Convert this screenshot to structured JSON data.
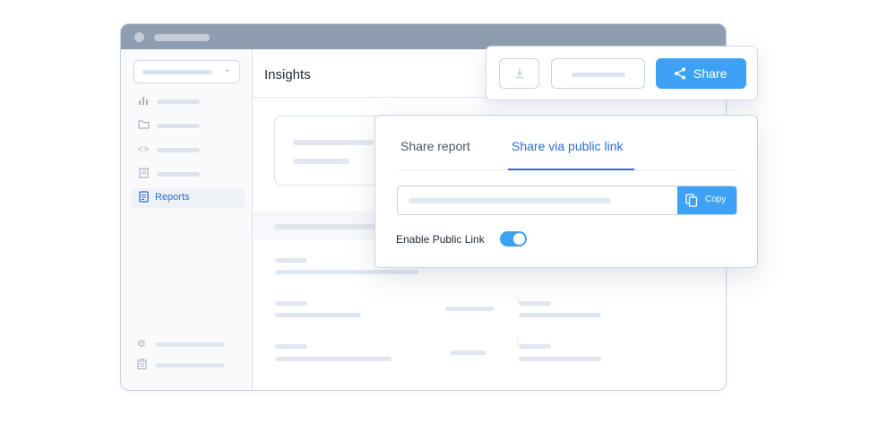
{
  "header": {
    "title": "Insights"
  },
  "sidebar": {
    "items": [
      {
        "icon": "bar-chart-icon"
      },
      {
        "icon": "folder-icon"
      },
      {
        "icon": "code-icon"
      },
      {
        "icon": "documents-icon"
      },
      {
        "icon": "report-icon",
        "label": "Reports",
        "active": true
      }
    ],
    "footer": [
      {
        "icon": "gear-icon"
      },
      {
        "icon": "clipboard-icon"
      }
    ]
  },
  "toolbar": {
    "download_icon": "download-icon",
    "share_label": "Share",
    "share_icon": "share-icon"
  },
  "share_dialog": {
    "tabs": [
      {
        "label": "Share report",
        "active": false
      },
      {
        "label": "Share via public link",
        "active": true
      }
    ],
    "copy_label": "Copy",
    "copy_icon": "copy-icon",
    "toggle_label": "Enable Public Link",
    "toggle_on": true
  },
  "colors": {
    "accent": "#3da1f5",
    "link": "#2a6fd6",
    "titlebar": "#8f9db0"
  }
}
